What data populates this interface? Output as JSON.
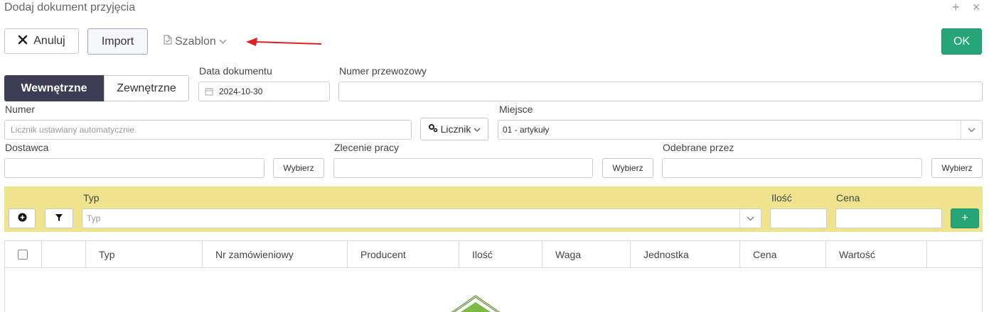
{
  "window": {
    "title": "Dodaj dokument przyjęcia",
    "add_icon": "+",
    "close_icon": "×"
  },
  "toolbar": {
    "cancel_label": "Anuluj",
    "import_label": "Import",
    "template_label": "Szablon",
    "ok_label": "OK"
  },
  "doc_type": {
    "internal": "Wewnętrzne",
    "external": "Zewnętrzne"
  },
  "fields": {
    "date_label": "Data dokumentu",
    "date_value": "2024-10-30",
    "carrier_label": "Numer przewozowy",
    "number_label": "Numer",
    "number_placeholder": "Licznik ustawiany automatycznie.",
    "counter_label": "Licznik",
    "place_label": "Miejsce",
    "place_value": "01 - artykuły",
    "supplier_label": "Dostawca",
    "work_order_label": "Zlecenie pracy",
    "received_by_label": "Odebrane przez",
    "choose_label": "Wybierz"
  },
  "add_row": {
    "type_label": "Typ",
    "type_placeholder": "Typ",
    "qty_label": "Ilość",
    "price_label": "Cena",
    "add_label": "+"
  },
  "table": {
    "columns": [
      "Typ",
      "Nr zamówieniowy",
      "Producent",
      "Ilość",
      "Waga",
      "Jednostka",
      "Cena",
      "Wartość"
    ]
  },
  "colors": {
    "accent": "#3d3c55",
    "ok": "#26a579",
    "yellow_bar": "#efe48d",
    "arrow": "#e02020"
  }
}
